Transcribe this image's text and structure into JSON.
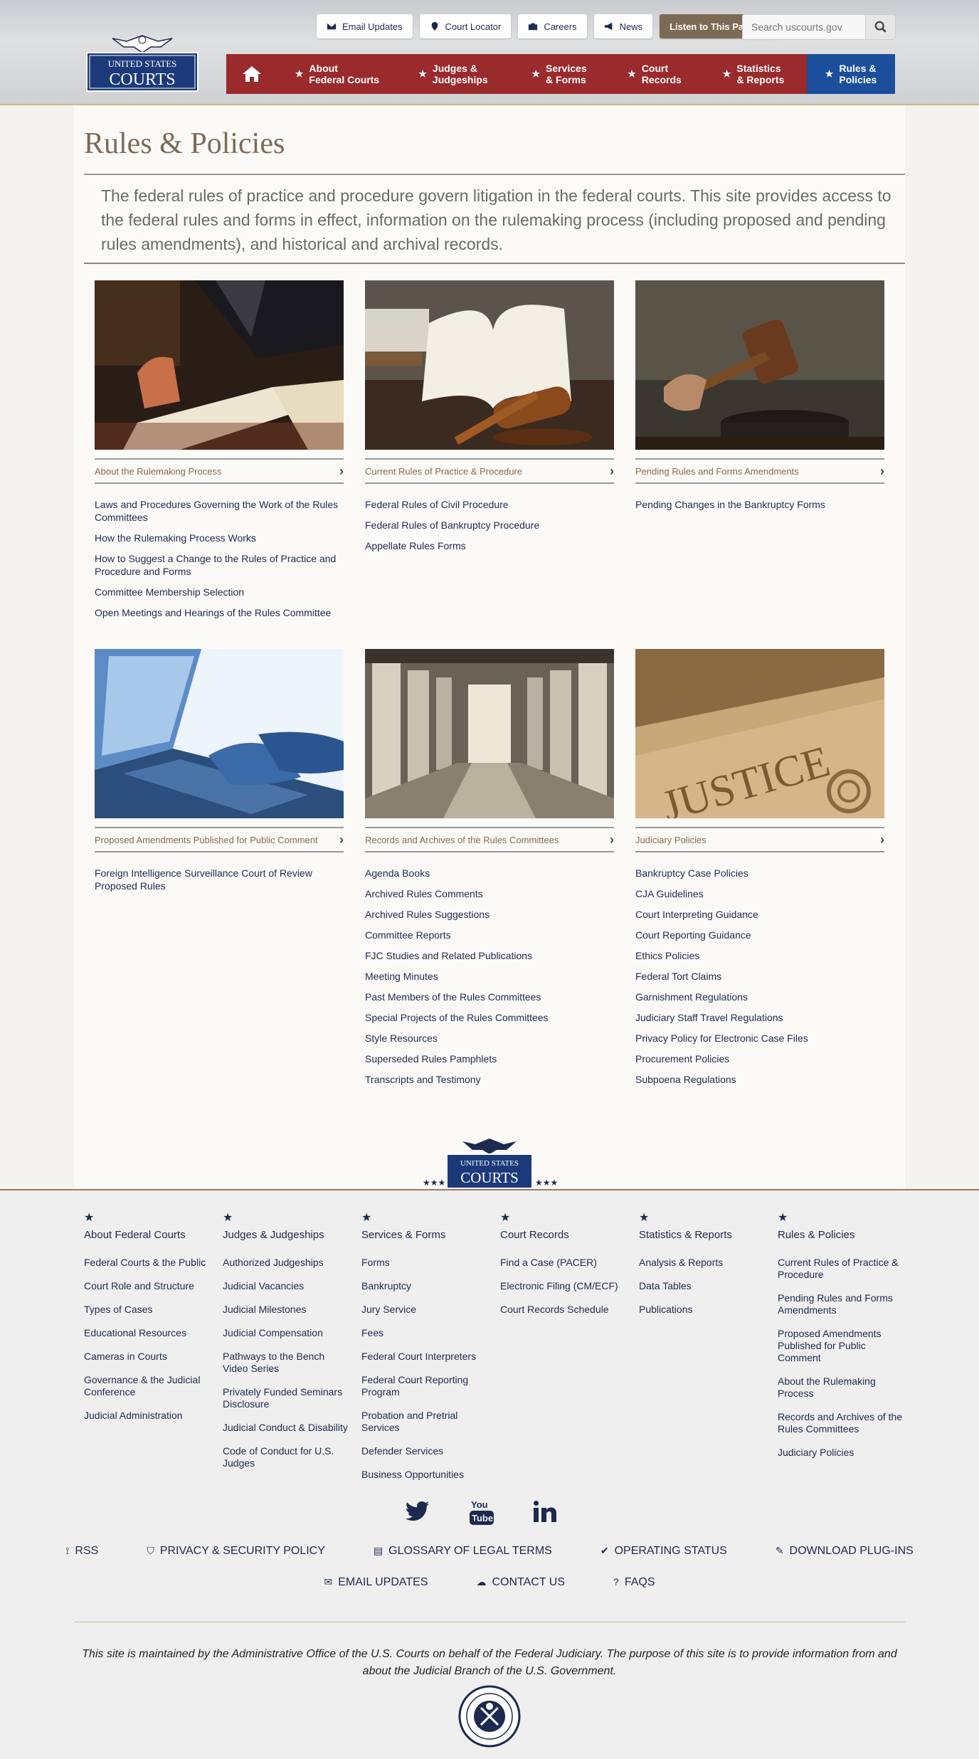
{
  "header": {
    "logo_line1": "UNITED STATES",
    "logo_line2": "COURTS",
    "util": [
      {
        "label": "Email Updates",
        "icon": "envelope-icon"
      },
      {
        "label": "Court Locator",
        "icon": "map-marker-icon"
      },
      {
        "label": "Careers",
        "icon": "briefcase-icon"
      },
      {
        "label": "News",
        "icon": "megaphone-icon"
      }
    ],
    "listen_label": "Listen to This Page",
    "search_placeholder": "Search uscourts.gov",
    "nav": [
      {
        "line1": "About",
        "line2": "Federal Courts"
      },
      {
        "line1": "Judges &",
        "line2": "Judgeships"
      },
      {
        "line1": "Services",
        "line2": "& Forms"
      },
      {
        "line1": "Court",
        "line2": "Records"
      },
      {
        "line1": "Statistics",
        "line2": "& Reports"
      },
      {
        "line1": "Rules &",
        "line2": "Policies"
      }
    ]
  },
  "main": {
    "title": "Rules & Policies",
    "intro": "The federal rules of practice and procedure govern litigation in the federal courts. This site provides access to the federal rules and forms in effect, information on the rulemaking process (including proposed and pending rules amendments), and historical and archival records.",
    "cards": [
      {
        "category": "About the Rulemaking Process",
        "links": [
          "Laws and Procedures Governing the Work of the Rules Committees",
          "How the Rulemaking Process Works",
          "How to Suggest a Change to the Rules of Practice and Procedure and Forms",
          "Committee Membership Selection",
          "Open Meetings and Hearings of the Rules Committee"
        ]
      },
      {
        "category": "Current Rules of Practice & Procedure",
        "links": [
          "Federal Rules of Civil Procedure",
          "Federal Rules of Bankruptcy Procedure",
          "Appellate Rules Forms"
        ]
      },
      {
        "category": "Pending Rules and Forms Amendments",
        "links": [
          "Pending Changes in the Bankruptcy Forms"
        ]
      },
      {
        "category": "Proposed Amendments Published for Public Comment",
        "links": [
          "Foreign Intelligence Surveillance Court of Review Proposed Rules"
        ]
      },
      {
        "category": "Records and Archives of the Rules Committees",
        "links": [
          "Agenda Books",
          "Archived Rules Comments",
          "Archived Rules Suggestions",
          "Committee Reports",
          "FJC Studies and Related Publications",
          "Meeting Minutes",
          "Past Members of the Rules Committees",
          "Special Projects of the Rules Committees",
          "Style Resources",
          "Superseded Rules Pamphlets",
          "Transcripts and Testimony"
        ]
      },
      {
        "category": "Judiciary Policies",
        "links": [
          "Bankruptcy Case Policies",
          "CJA Guidelines",
          "Court Interpreting Guidance",
          "Court Reporting Guidance",
          "Ethics Policies",
          "Federal Tort Claims",
          "Garnishment Regulations",
          "Judiciary Staff Travel Regulations",
          "Privacy Policy for Electronic Case Files",
          "Procurement Policies",
          "Subpoena Regulations"
        ]
      }
    ],
    "justice_word": "JUSTICE"
  },
  "footer": {
    "columns": [
      {
        "title": "About Federal Courts",
        "links": [
          "Federal Courts & the Public",
          "Court Role and Structure",
          "Types of Cases",
          "Educational Resources",
          "Cameras in Courts",
          "Governance & the Judicial Conference",
          "Judicial Administration"
        ]
      },
      {
        "title": "Judges & Judgeships",
        "links": [
          "Authorized Judgeships",
          "Judicial Vacancies",
          "Judicial Milestones",
          "Judicial Compensation",
          "Pathways to the Bench Video Series",
          "Privately Funded Seminars Disclosure",
          "Judicial Conduct & Disability",
          "Code of Conduct for U.S. Judges"
        ]
      },
      {
        "title": "Services & Forms",
        "links": [
          "Forms",
          "Bankruptcy",
          "Jury Service",
          "Fees",
          "Federal Court Interpreters",
          "Federal Court Reporting Program",
          "Probation and Pretrial Services",
          "Defender Services",
          "Business Opportunities"
        ]
      },
      {
        "title": "Court Records",
        "links": [
          "Find a Case (PACER)",
          "Electronic Filing (CM/ECF)",
          "Court Records Schedule"
        ]
      },
      {
        "title": "Statistics & Reports",
        "links": [
          "Analysis & Reports",
          "Data Tables",
          "Publications"
        ]
      },
      {
        "title": "Rules & Policies",
        "links": [
          "Current Rules of Practice & Procedure",
          "Pending Rules and Forms Amendments",
          "Proposed Amendments Published for Public Comment",
          "About the Rulemaking Process",
          "Records and Archives of the Rules Committees",
          "Judiciary Policies"
        ]
      }
    ],
    "social": [
      "twitter-icon",
      "youtube-icon",
      "linkedin-icon"
    ],
    "links_row1": [
      {
        "label": "RSS",
        "icon": "rss-icon"
      },
      {
        "label": "PRIVACY & SECURITY POLICY",
        "icon": "shield-icon"
      },
      {
        "label": "GLOSSARY OF LEGAL TERMS",
        "icon": "book-icon"
      },
      {
        "label": "OPERATING STATUS",
        "icon": "check-circle-icon"
      },
      {
        "label": "DOWNLOAD PLUG-INS",
        "icon": "wrench-icon"
      }
    ],
    "links_row2": [
      {
        "label": "EMAIL UPDATES",
        "icon": "envelope-icon"
      },
      {
        "label": "CONTACT US",
        "icon": "chat-icon"
      },
      {
        "label": "FAQS",
        "icon": "question-icon"
      }
    ],
    "disclaimer": "This site is maintained by the Administrative Office of the U.S. Courts on behalf of the Federal Judiciary. The purpose of this site is to provide information from and about the Judicial Branch of the U.S. Government."
  },
  "colors": {
    "nav_red": "#9a2a2c",
    "nav_active_blue": "#1b4f9c",
    "title_brown": "#7d6a55",
    "link_navy": "#1c2a4f"
  }
}
